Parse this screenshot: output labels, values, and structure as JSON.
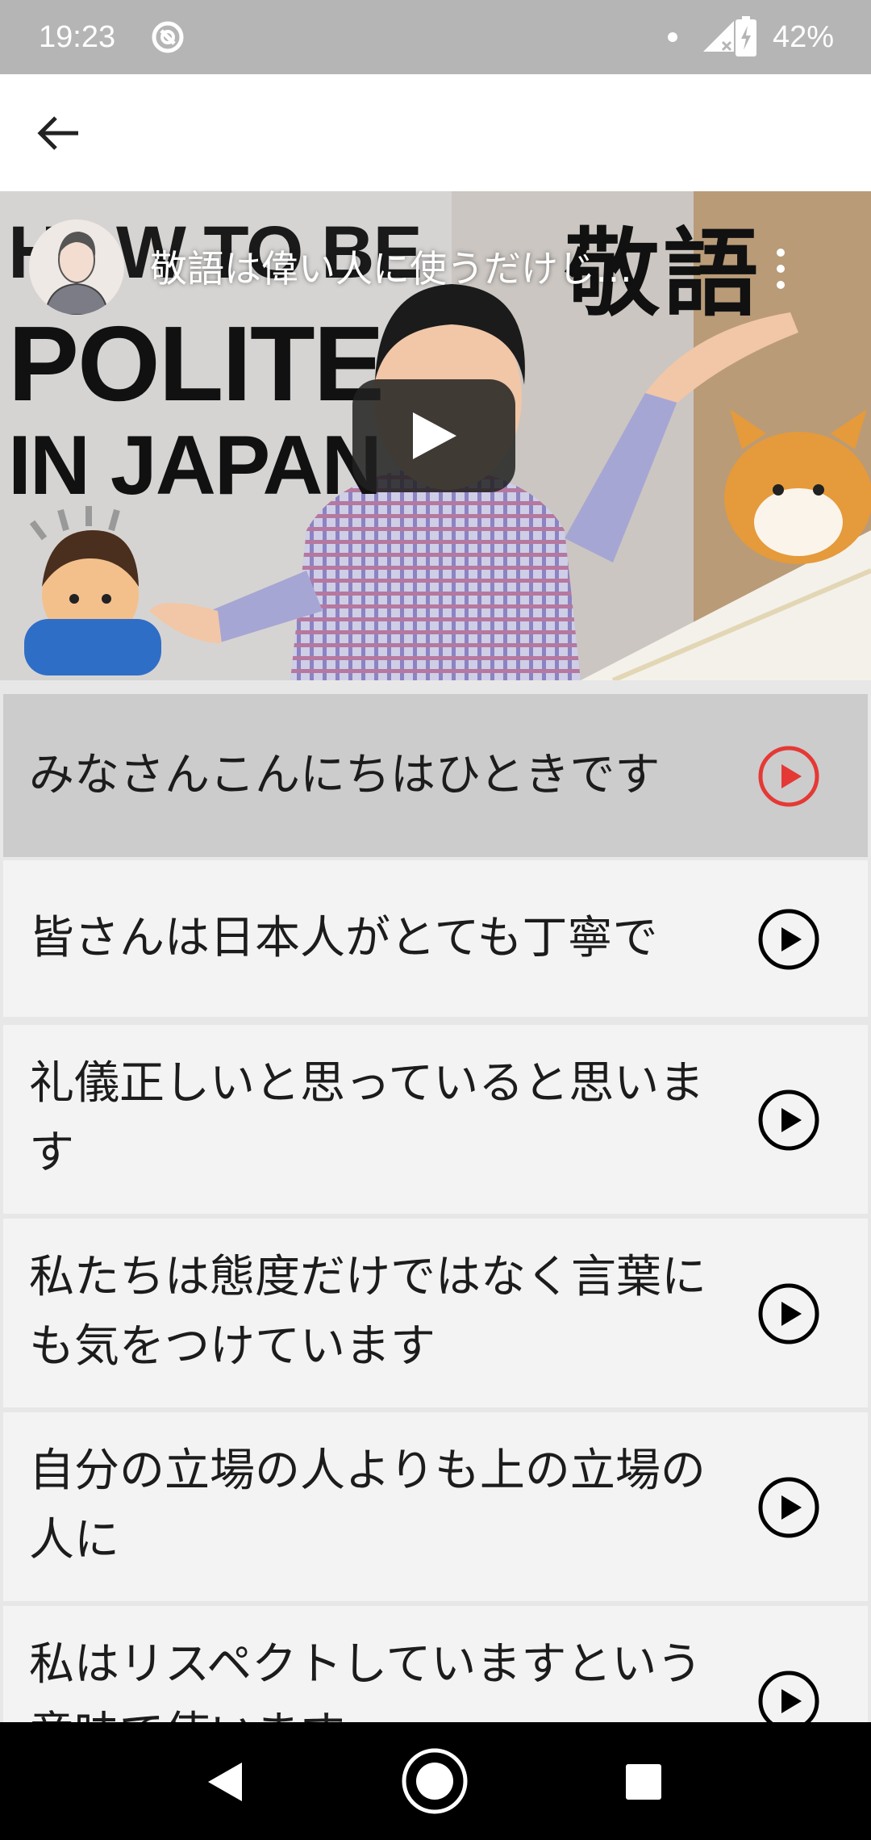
{
  "status_bar": {
    "time": "19:23",
    "battery": "42%",
    "icons": [
      "sync-disabled-icon",
      "notification-dot-icon",
      "signal-icon",
      "battery-charging-icon"
    ]
  },
  "app_bar": {
    "back_icon": "arrow-back-icon"
  },
  "video": {
    "title": "敬語は偉い人に使うだけじ…",
    "thumbnail_text": [
      "HOW TO BE",
      "POLITE",
      "IN JAPAN"
    ],
    "thumbnail_kanji": "敬語",
    "play_icon": "play-icon",
    "menu_icon": "more-vert-icon"
  },
  "sentences": [
    {
      "text": "みなさんこんにちはひときです",
      "active": true
    },
    {
      "text": "皆さんは日本人がとても丁寧で",
      "active": false
    },
    {
      "text": "礼儀正しいと思っていると思います",
      "active": false
    },
    {
      "text": "私たちは態度だけではなく言葉にも気をつけています",
      "active": false
    },
    {
      "text": "自分の立場の人よりも上の立場の人に",
      "active": false
    },
    {
      "text": "私はリスペクトしていますという意味で使います",
      "active": false
    }
  ],
  "colors": {
    "active_play": "#e53935",
    "play": "#000000",
    "status_bar": "#b5b5b5",
    "active_row": "#cccccc",
    "row": "#f3f3f3"
  },
  "nav_bar": {
    "icons": [
      "back-triangle-icon",
      "home-circle-icon",
      "recents-square-icon"
    ]
  }
}
